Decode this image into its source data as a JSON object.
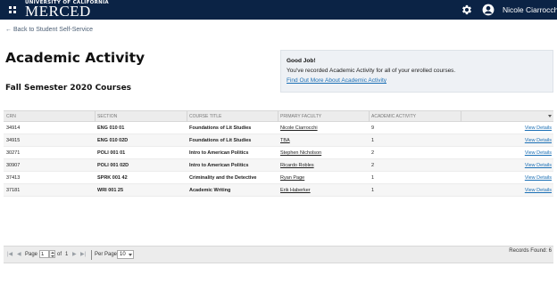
{
  "header": {
    "logo_top": "UNIVERSITY OF CALIFORNIA",
    "logo_main": "MERCED",
    "user_name": "Nicole Ciarrocchi",
    "icons": [
      "apps-grid-icon",
      "gear-icon",
      "user-avatar-icon"
    ]
  },
  "nav": {
    "back_link": "← Back to Student Self-Service"
  },
  "page": {
    "title": "Academic Activity",
    "term_title": "Fall Semester 2020 Courses"
  },
  "notice": {
    "title": "Good Job!",
    "message": "You've recorded Academic Activity for all of your enrolled courses.",
    "link": "Find Out More About Academic Activity"
  },
  "table": {
    "columns": [
      "CRN",
      "SECTION",
      "COURSE TITLE",
      "PRIMARY FACULTY",
      "ACADEMIC ACTIVITY"
    ],
    "rows": [
      {
        "crn": "34914",
        "section": "ENG 010 01",
        "title": "Foundations of Lit Studies",
        "faculty": "Nicole Ciarrocchi",
        "activity": "9",
        "action": "View Details"
      },
      {
        "crn": "34915",
        "section": "ENG 010 02D",
        "title": "Foundations of Lit Studies",
        "faculty": "TBA",
        "activity": "1",
        "action": "View Details"
      },
      {
        "crn": "30271",
        "section": "POLI 001 01",
        "title": "Intro to American Politics",
        "faculty": "Stephen Nicholson",
        "activity": "2",
        "action": "View Details"
      },
      {
        "crn": "30907",
        "section": "POLI 001 02D",
        "title": "Intro to American Politics",
        "faculty": "Ricardo Robles",
        "activity": "2",
        "action": "View Details"
      },
      {
        "crn": "37413",
        "section": "SPRK 001 42",
        "title": "Criminality and the Detective",
        "faculty": "Ryan Page",
        "activity": "1",
        "action": "View Details"
      },
      {
        "crn": "37181",
        "section": "WRI 001 25",
        "title": "Academic Writing",
        "faculty": "Erik Haberker",
        "activity": "1",
        "action": "View Details"
      }
    ]
  },
  "pager": {
    "page_label": "Page",
    "page_value": "1",
    "of_label": "of",
    "total_pages": "1",
    "per_page_label": "Per Page",
    "per_page_value": "10",
    "records_found": "Records Found: 6"
  }
}
